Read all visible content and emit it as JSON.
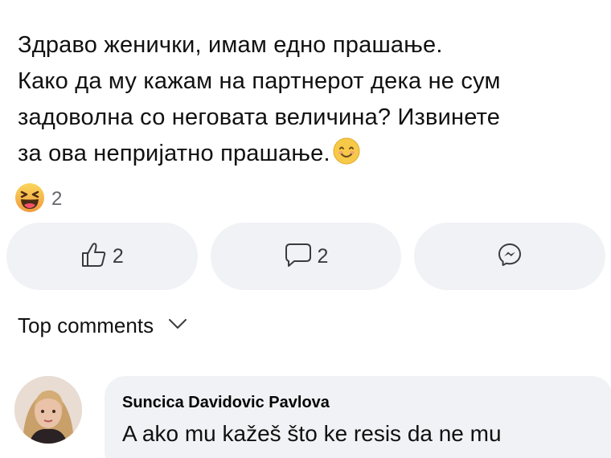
{
  "post": {
    "lines": [
      "Здраво женички, имам едно прашање.",
      "Како да му кажам на партнерот дека не сум",
      "задоволна со неговата величина? Извинете",
      "за ова непријатно прашање."
    ]
  },
  "reactions": {
    "icon": "laughing-emoji",
    "count": "2"
  },
  "actions": {
    "like_count": "2",
    "comment_count": "2"
  },
  "comments_section": {
    "label": "Top comments"
  },
  "comment": {
    "author": "Suncica Davidovic Pavlova",
    "text": "A ako mu kažeš što ke resis da ne mu"
  },
  "colors": {
    "pill_bg": "#f0f2f5",
    "muted_text": "#65676b",
    "emoji_yellow": "#f7c948",
    "emoji_orange": "#f19a3e"
  }
}
